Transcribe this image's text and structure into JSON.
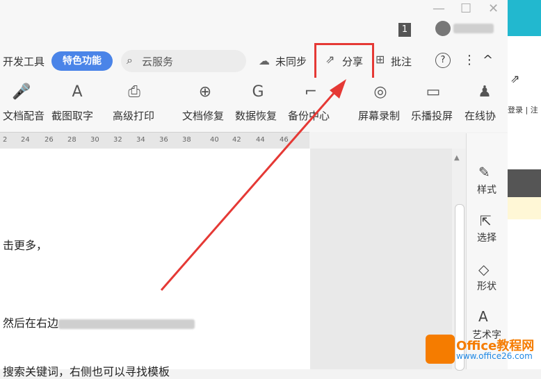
{
  "titlebar": {
    "badge": "1",
    "username_blurred": "▓▓▓"
  },
  "tabs": {
    "dev_tools": "开发工具",
    "special": "特色功能",
    "cloud": "云服务"
  },
  "toolbar_right": {
    "unsynced": "未同步",
    "share": "分享",
    "annotate": "批注",
    "help": "?",
    "more": "⋮",
    "collapse": "^"
  },
  "ribbon": {
    "items": [
      {
        "label": "文档配音"
      },
      {
        "label": "截图取字"
      },
      {
        "label": "高级打印"
      },
      {
        "label": "文档修复"
      },
      {
        "label": "数据恢复"
      },
      {
        "label": "备份中心"
      },
      {
        "label": "屏幕录制"
      },
      {
        "label": "乐播投屏"
      },
      {
        "label": "在线协"
      }
    ]
  },
  "ruler": {
    "ticks": [
      "2",
      "24",
      "26",
      "28",
      "30",
      "32",
      "34",
      "36",
      "38",
      "40",
      "42",
      "44",
      "46"
    ]
  },
  "sidebar": {
    "items": [
      {
        "label": "样式"
      },
      {
        "label": "选择"
      },
      {
        "label": "形状"
      },
      {
        "label": "艺术字"
      }
    ]
  },
  "document": {
    "line1": "击更多，",
    "line2": "然后在右边",
    "line3": "搜索关键词，右侧也可以寻找模板"
  },
  "right_strip": {
    "login": "登录 | 注"
  },
  "watermark": {
    "brand": "Office教程网",
    "url": "www.office26.com"
  }
}
